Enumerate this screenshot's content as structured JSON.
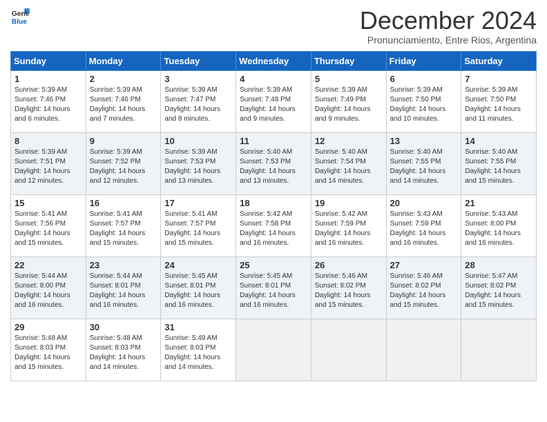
{
  "logo": {
    "general": "General",
    "blue": "Blue"
  },
  "title": "December 2024",
  "subtitle": "Pronunciamiento, Entre Rios, Argentina",
  "days_of_week": [
    "Sunday",
    "Monday",
    "Tuesday",
    "Wednesday",
    "Thursday",
    "Friday",
    "Saturday"
  ],
  "weeks": [
    {
      "alt": false,
      "days": [
        {
          "num": "1",
          "sunrise": "5:39 AM",
          "sunset": "7:46 PM",
          "daylight": "14 hours and 6 minutes."
        },
        {
          "num": "2",
          "sunrise": "5:39 AM",
          "sunset": "7:46 PM",
          "daylight": "14 hours and 7 minutes."
        },
        {
          "num": "3",
          "sunrise": "5:39 AM",
          "sunset": "7:47 PM",
          "daylight": "14 hours and 8 minutes."
        },
        {
          "num": "4",
          "sunrise": "5:39 AM",
          "sunset": "7:48 PM",
          "daylight": "14 hours and 9 minutes."
        },
        {
          "num": "5",
          "sunrise": "5:39 AM",
          "sunset": "7:49 PM",
          "daylight": "14 hours and 9 minutes."
        },
        {
          "num": "6",
          "sunrise": "5:39 AM",
          "sunset": "7:50 PM",
          "daylight": "14 hours and 10 minutes."
        },
        {
          "num": "7",
          "sunrise": "5:39 AM",
          "sunset": "7:50 PM",
          "daylight": "14 hours and 11 minutes."
        }
      ]
    },
    {
      "alt": true,
      "days": [
        {
          "num": "8",
          "sunrise": "5:39 AM",
          "sunset": "7:51 PM",
          "daylight": "14 hours and 12 minutes."
        },
        {
          "num": "9",
          "sunrise": "5:39 AM",
          "sunset": "7:52 PM",
          "daylight": "14 hours and 12 minutes."
        },
        {
          "num": "10",
          "sunrise": "5:39 AM",
          "sunset": "7:53 PM",
          "daylight": "14 hours and 13 minutes."
        },
        {
          "num": "11",
          "sunrise": "5:40 AM",
          "sunset": "7:53 PM",
          "daylight": "14 hours and 13 minutes."
        },
        {
          "num": "12",
          "sunrise": "5:40 AM",
          "sunset": "7:54 PM",
          "daylight": "14 hours and 14 minutes."
        },
        {
          "num": "13",
          "sunrise": "5:40 AM",
          "sunset": "7:55 PM",
          "daylight": "14 hours and 14 minutes."
        },
        {
          "num": "14",
          "sunrise": "5:40 AM",
          "sunset": "7:55 PM",
          "daylight": "14 hours and 15 minutes."
        }
      ]
    },
    {
      "alt": false,
      "days": [
        {
          "num": "15",
          "sunrise": "5:41 AM",
          "sunset": "7:56 PM",
          "daylight": "14 hours and 15 minutes."
        },
        {
          "num": "16",
          "sunrise": "5:41 AM",
          "sunset": "7:57 PM",
          "daylight": "14 hours and 15 minutes."
        },
        {
          "num": "17",
          "sunrise": "5:41 AM",
          "sunset": "7:57 PM",
          "daylight": "14 hours and 15 minutes."
        },
        {
          "num": "18",
          "sunrise": "5:42 AM",
          "sunset": "7:58 PM",
          "daylight": "14 hours and 16 minutes."
        },
        {
          "num": "19",
          "sunrise": "5:42 AM",
          "sunset": "7:59 PM",
          "daylight": "14 hours and 16 minutes."
        },
        {
          "num": "20",
          "sunrise": "5:43 AM",
          "sunset": "7:59 PM",
          "daylight": "14 hours and 16 minutes."
        },
        {
          "num": "21",
          "sunrise": "5:43 AM",
          "sunset": "8:00 PM",
          "daylight": "14 hours and 16 minutes."
        }
      ]
    },
    {
      "alt": true,
      "days": [
        {
          "num": "22",
          "sunrise": "5:44 AM",
          "sunset": "8:00 PM",
          "daylight": "14 hours and 16 minutes."
        },
        {
          "num": "23",
          "sunrise": "5:44 AM",
          "sunset": "8:01 PM",
          "daylight": "14 hours and 16 minutes."
        },
        {
          "num": "24",
          "sunrise": "5:45 AM",
          "sunset": "8:01 PM",
          "daylight": "14 hours and 16 minutes."
        },
        {
          "num": "25",
          "sunrise": "5:45 AM",
          "sunset": "8:01 PM",
          "daylight": "14 hours and 16 minutes."
        },
        {
          "num": "26",
          "sunrise": "5:46 AM",
          "sunset": "8:02 PM",
          "daylight": "14 hours and 15 minutes."
        },
        {
          "num": "27",
          "sunrise": "5:46 AM",
          "sunset": "8:02 PM",
          "daylight": "14 hours and 15 minutes."
        },
        {
          "num": "28",
          "sunrise": "5:47 AM",
          "sunset": "8:02 PM",
          "daylight": "14 hours and 15 minutes."
        }
      ]
    },
    {
      "alt": false,
      "days": [
        {
          "num": "29",
          "sunrise": "5:48 AM",
          "sunset": "8:03 PM",
          "daylight": "14 hours and 15 minutes."
        },
        {
          "num": "30",
          "sunrise": "5:48 AM",
          "sunset": "8:03 PM",
          "daylight": "14 hours and 14 minutes."
        },
        {
          "num": "31",
          "sunrise": "5:49 AM",
          "sunset": "8:03 PM",
          "daylight": "14 hours and 14 minutes."
        },
        null,
        null,
        null,
        null
      ]
    }
  ],
  "labels": {
    "sunrise_prefix": "Sunrise: ",
    "sunset_prefix": "Sunset: ",
    "daylight_prefix": "Daylight: "
  }
}
